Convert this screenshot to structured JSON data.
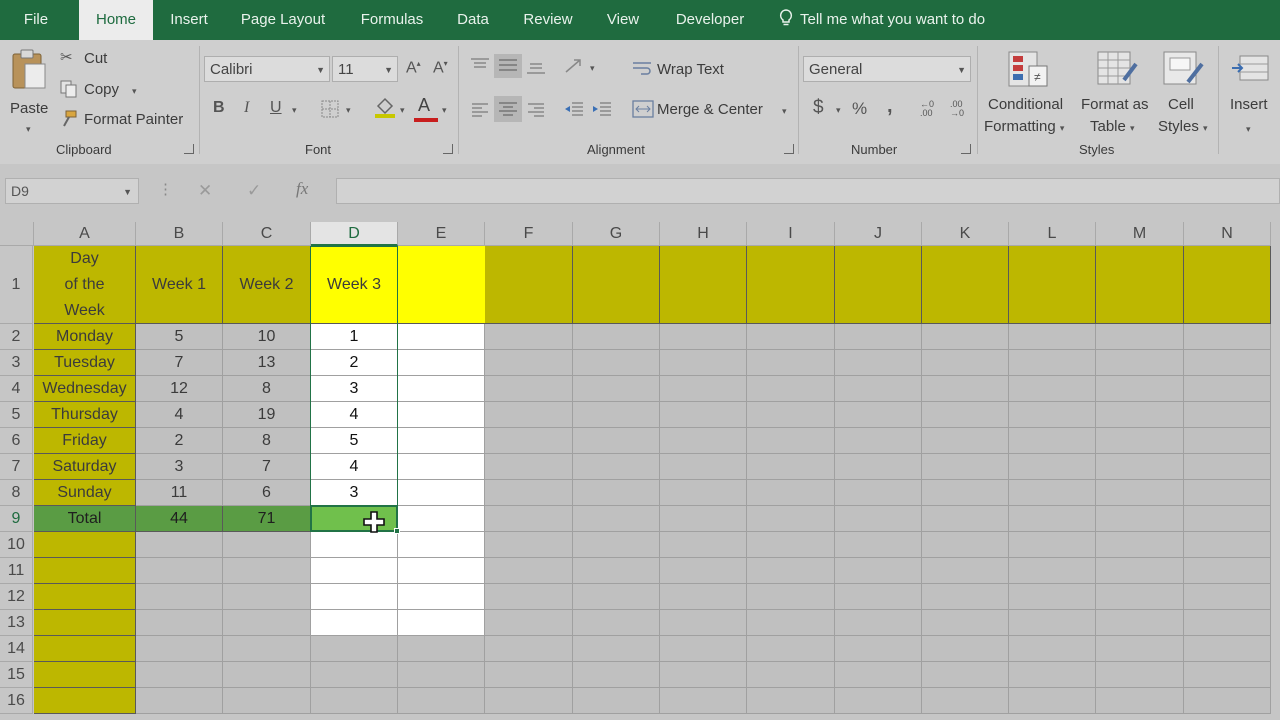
{
  "menu": {
    "tabs": [
      "File",
      "Home",
      "Insert",
      "Page Layout",
      "Formulas",
      "Data",
      "Review",
      "View",
      "Developer"
    ],
    "active_tab": "Home",
    "tell_me": "Tell me what you want to do"
  },
  "ribbon": {
    "clipboard": {
      "label": "Clipboard",
      "paste": "Paste",
      "cut": "Cut",
      "copy": "Copy",
      "format_painter": "Format Painter"
    },
    "font": {
      "label": "Font",
      "font_name": "Calibri",
      "font_size": "11",
      "bold": "B",
      "italic": "I",
      "underline": "U"
    },
    "alignment": {
      "label": "Alignment",
      "wrap_text": "Wrap Text",
      "merge_center": "Merge & Center"
    },
    "number": {
      "label": "Number",
      "format": "General",
      "currency": "$",
      "percent": "%",
      "comma": ","
    },
    "styles": {
      "label": "Styles",
      "conditional_formatting": [
        "Conditional",
        "Formatting"
      ],
      "format_as_table": [
        "Format as",
        "Table"
      ],
      "cell_styles": [
        "Cell",
        "Styles"
      ]
    },
    "cells": {
      "insert": "Insert"
    }
  },
  "formula_bar": {
    "name_box": "D9",
    "cancel": "✕",
    "enter": "✓",
    "fx": "fx",
    "value": ""
  },
  "sheet": {
    "columns": [
      "A",
      "B",
      "C",
      "D",
      "E",
      "F",
      "G",
      "H",
      "I",
      "J",
      "K",
      "L",
      "M",
      "N"
    ],
    "rows": [
      "1",
      "2",
      "3",
      "4",
      "5",
      "6",
      "7",
      "8",
      "9",
      "10",
      "11",
      "12",
      "13",
      "14",
      "15",
      "16"
    ],
    "header_row": [
      "Day\nof the\nWeek",
      "Week 1",
      "Week 2",
      "Week 3"
    ],
    "data": [
      [
        "Monday",
        "5",
        "10",
        "1"
      ],
      [
        "Tuesday",
        "7",
        "13",
        "2"
      ],
      [
        "Wednesday",
        "12",
        "8",
        "3"
      ],
      [
        "Thursday",
        "4",
        "19",
        "4"
      ],
      [
        "Friday",
        "2",
        "8",
        "5"
      ],
      [
        "Saturday",
        "3",
        "7",
        "4"
      ],
      [
        "Sunday",
        "11",
        "6",
        "3"
      ]
    ],
    "total_row": [
      "Total",
      "44",
      "71",
      ""
    ],
    "selected_cell": "D9",
    "colors": {
      "header_yellow": "#ffff00",
      "total_green": "#70c04c",
      "selection_green": "#217346"
    }
  }
}
